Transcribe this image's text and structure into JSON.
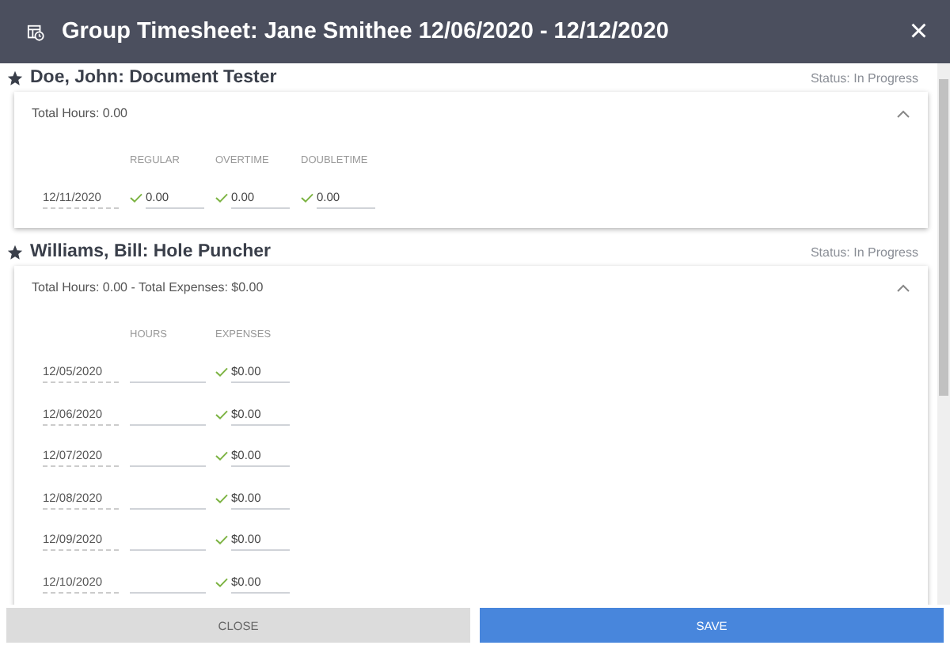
{
  "window": {
    "title": "Group Timesheet: Jane Smithee 12/06/2020 - 12/12/2020",
    "close": "×"
  },
  "sections": [
    {
      "name": "Doe, John: Document Tester",
      "starred": true,
      "status": "Status: In Progress",
      "summary": "Total Hours: 0.00",
      "expanded": true,
      "columns": [
        "REGULAR",
        "OVERTIME",
        "DOUBLETIME"
      ],
      "rows": [
        {
          "date": "12/11/2020",
          "cells": [
            {
              "value": "0.00",
              "valid": true
            },
            {
              "value": "0.00",
              "valid": true
            },
            {
              "value": "0.00",
              "valid": true
            }
          ]
        }
      ]
    },
    {
      "name": "Williams, Bill: Hole Puncher",
      "starred": true,
      "status": "Status: In Progress",
      "summary": "Total Hours: 0.00 - Total Expenses: $0.00",
      "expanded": true,
      "columns": [
        "HOURS",
        "EXPENSES"
      ],
      "rows": [
        {
          "date": "12/05/2020",
          "cells": [
            {
              "valid": false
            },
            {
              "value": "$0.00",
              "valid": true
            }
          ]
        },
        {
          "date": "12/06/2020",
          "cells": [
            {
              "valid": false
            },
            {
              "value": "$0.00",
              "valid": true
            }
          ]
        },
        {
          "date": "12/07/2020",
          "cells": [
            {
              "valid": false
            },
            {
              "value": "$0.00",
              "valid": true
            }
          ]
        },
        {
          "date": "12/08/2020",
          "cells": [
            {
              "valid": false
            },
            {
              "value": "$0.00",
              "valid": true
            }
          ]
        },
        {
          "date": "12/09/2020",
          "cells": [
            {
              "valid": false
            },
            {
              "value": "$0.00",
              "valid": true
            }
          ]
        },
        {
          "date": "12/10/2020",
          "cells": [
            {
              "valid": false
            },
            {
              "value": "$0.00",
              "valid": true
            }
          ]
        }
      ]
    }
  ],
  "buttons": [
    {
      "label": "CLOSE",
      "kind": "secondary"
    },
    {
      "label": "SAVE",
      "kind": "primary"
    }
  ]
}
